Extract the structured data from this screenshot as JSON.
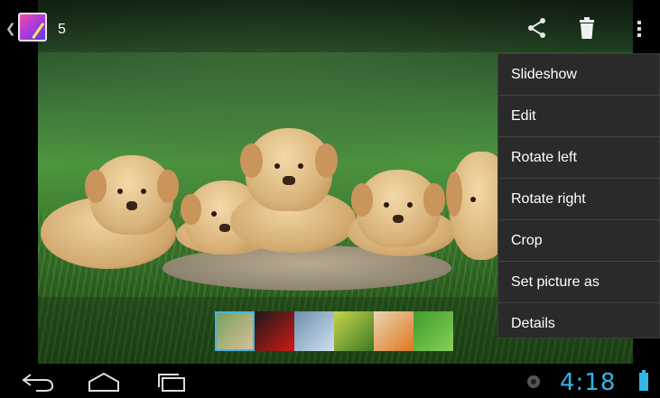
{
  "action_bar": {
    "count": "5",
    "icons": [
      "gallery-app-icon",
      "share-icon",
      "trash-icon",
      "overflow-menu-icon"
    ]
  },
  "menu": {
    "items": [
      "Slideshow",
      "Edit",
      "Rotate left",
      "Rotate right",
      "Crop",
      "Set picture as",
      "Details"
    ]
  },
  "filmstrip": {
    "thumbnails": [
      {
        "name": "puppies",
        "colors": [
          "#7aa05a",
          "#d6c09a"
        ]
      },
      {
        "name": "red-car",
        "colors": [
          "#1a1a1a",
          "#d01818"
        ]
      },
      {
        "name": "bridge",
        "colors": [
          "#6e8fae",
          "#cfe0ef"
        ]
      },
      {
        "name": "flower",
        "colors": [
          "#c7d34a",
          "#3d7a22"
        ]
      },
      {
        "name": "soccer-player",
        "colors": [
          "#e9d6b5",
          "#e0761e"
        ]
      },
      {
        "name": "water-drops",
        "colors": [
          "#3f9b2a",
          "#88d05a"
        ]
      }
    ],
    "selected_index": 0
  },
  "status_bar": {
    "time": "4:18",
    "accent": "#33b5e5"
  }
}
